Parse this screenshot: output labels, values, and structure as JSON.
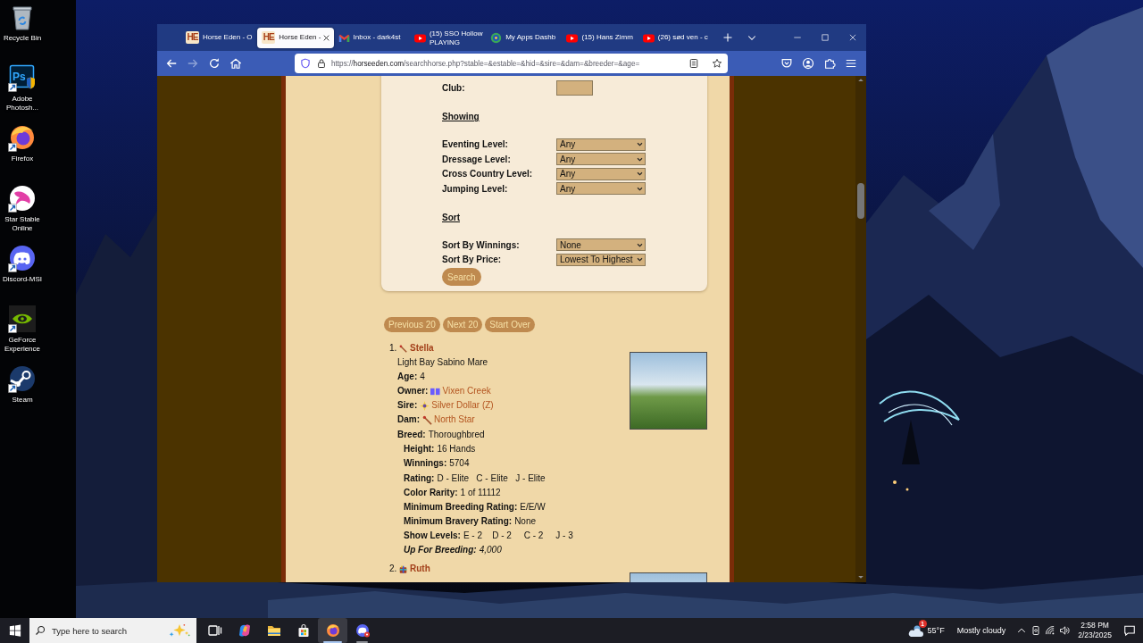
{
  "desktop_icons": [
    {
      "label": "Recycle Bin"
    },
    {
      "label": "Adobe Photosh...",
      "logo_text": "Ps"
    },
    {
      "label": "Firefox"
    },
    {
      "label": "Star Stable Online"
    },
    {
      "label": "Discord-MSI"
    },
    {
      "label": "GeForce Experience"
    },
    {
      "label": "Steam"
    }
  ],
  "browser": {
    "tabs": [
      {
        "title": "Horse Eden - O",
        "favicon_text": "HE",
        "selected": false
      },
      {
        "title": "Horse Eden -",
        "favicon_text": "HE",
        "selected": true
      },
      {
        "title": "Inbox - dark4st",
        "selected": false
      },
      {
        "title": "(15) SSO Hollow",
        "subtitle": "PLAYING",
        "selected": false
      },
      {
        "title": "My Apps Dashb",
        "selected": false
      },
      {
        "title": "(15) Hans Zimm",
        "selected": false
      },
      {
        "title": "(26) sød ven - c",
        "selected": false
      }
    ],
    "nav_buttons": [
      {
        "disabled": false
      },
      {
        "disabled": true
      },
      {
        "disabled": false
      },
      {
        "disabled": false
      }
    ],
    "url": {
      "scheme": "https://",
      "host": "horseeden.com",
      "path": "/searchhorse.php?stable=&estable=&hid=&sire=&dam=&breeder=&age="
    }
  },
  "page": {
    "search_form": {
      "rows": [
        {
          "kind": "input",
          "label": "Club:"
        },
        {
          "kind": "heading",
          "label": "Showing"
        },
        {
          "kind": "select",
          "label": "Eventing Level:",
          "value": "Any"
        },
        {
          "kind": "select",
          "label": "Dressage Level:",
          "value": "Any"
        },
        {
          "kind": "select",
          "label": "Cross Country Level:",
          "value": "Any"
        },
        {
          "kind": "select",
          "label": "Jumping Level:",
          "value": "Any"
        },
        {
          "kind": "heading",
          "label": "Sort"
        },
        {
          "kind": "select",
          "label": "Sort By Winnings:",
          "value": "None"
        },
        {
          "kind": "select",
          "label": "Sort By Price:",
          "value": "Lowest To Highest"
        }
      ],
      "submit": "Search"
    },
    "pager": [
      "Previous 20",
      "Next 20",
      "Start Over"
    ],
    "results": [
      {
        "number": "1.",
        "name": "Stella",
        "description": "Light Bay Sabino Mare",
        "details": [
          {
            "kind": "text",
            "label": "Age:",
            "value": "4"
          },
          {
            "kind": "link",
            "label": "Owner:",
            "value": "Vixen Creek"
          },
          {
            "kind": "link",
            "label": "Sire:",
            "value": "Silver Dollar (Z)"
          },
          {
            "kind": "link",
            "label": "Dam:",
            "value": "North Star"
          },
          {
            "kind": "text",
            "label": "Breed:",
            "value": "Thoroughbred"
          }
        ],
        "stats": [
          {
            "kind": "stat",
            "label": "Height:",
            "value": "16 Hands"
          },
          {
            "kind": "stat",
            "label": "Winnings:",
            "value": "5704"
          },
          {
            "kind": "stat",
            "label": "Rating:",
            "value": "D - Elite   C - Elite   J - Elite"
          },
          {
            "kind": "stat",
            "label": "Color Rarity:",
            "value": "1 of 11112"
          },
          {
            "kind": "stat",
            "label": "Minimum Breeding Rating:",
            "value": "E/E/W"
          },
          {
            "kind": "stat",
            "label": "Minimum Bravery Rating:",
            "value": "None"
          },
          {
            "kind": "stat",
            "label": "Show Levels:",
            "value": "E - 2    D - 2     C - 2     J - 3"
          },
          {
            "kind": "offer",
            "label": "Up For Breeding:",
            "value": "4,000"
          }
        ]
      },
      {
        "number": "2.",
        "name": "Ruth"
      }
    ]
  },
  "taskbar": {
    "search": {
      "placeholder": "Type here to search"
    },
    "apps": [
      {
        "running": false,
        "selected": false
      },
      {
        "running": false,
        "selected": false
      },
      {
        "running": false,
        "selected": false
      },
      {
        "running": false,
        "selected": false
      },
      {
        "running": true,
        "selected": true
      },
      {
        "running": true,
        "selected": false
      }
    ],
    "weather": {
      "badge": "1",
      "temperature": "55°F",
      "condition": "Mostly cloudy"
    },
    "clock": {
      "time": "2:58 PM",
      "date": "2/23/2025"
    }
  }
}
